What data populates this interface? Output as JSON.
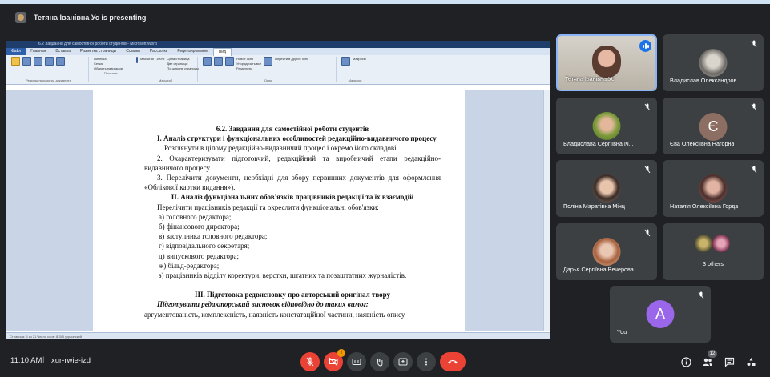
{
  "header": {
    "presenting_text": "Тетяна Іванівна Ус is presenting"
  },
  "screen": {
    "titlebar": "6.2 Завдання для самостійної роботи студентів - Microsoft Word",
    "tabs": [
      "Файл",
      "Главная",
      "Вставка",
      "Разметка страницы",
      "Ссылки",
      "Рассылки",
      "Рецензирование",
      "Вид"
    ],
    "ribbon_groups": [
      "Режимы просмотра документа",
      "Показать",
      "Масштаб",
      "Окно",
      "Макросы"
    ],
    "ribbon_items": [
      "Линейка",
      "Сетка",
      "Область навигации",
      "Масштаб",
      "100%",
      "Одна страница",
      "Две страницы",
      "По ширине страницы",
      "Новое окно",
      "Упорядочить все",
      "Разделить",
      "Перейти в другое окно",
      "Макросы"
    ],
    "status": "Страница: 5 из 21   Число слов: 8 345   украинский",
    "document": {
      "heading": "6.2. Завдання для самостійної роботи студентів",
      "section1_title": "I. Аналіз структури і функціональних особливостей редакційно-видавничого процесу",
      "items1": [
        "1. Розглянути в цілому редакційно-видавничий процес і окремо його складові.",
        "2. Охарактеризувати підготовчий, редакційний та виробничий етапи редакційно-видавничого процесу.",
        "3. Перелічити документи, необхідні для збору первинних документів для оформлення «Облікової картки видання»)."
      ],
      "section2_title": "II. Аналіз функціональних обов'язків працівників редакції та їх взаємодій",
      "section2_intro": "Перелічити працівників редакції та окреслити функціональні обов'язки:",
      "items2": [
        "а) головного редактора;",
        "б) фінансового директора;",
        "в) заступника головного редактора;",
        "г) відповідального секретаря;",
        "д) випускового редактора;",
        "ж) більд-редактора;",
        "з) працівників відділу коректури, верстки, штатних та позаштатних журналістів."
      ],
      "section3_title": "III. Підготовка редвисновку про авторський оригінал твору",
      "section3_italic": "Підготувати редакторський висновок відповідно до таких вимог:",
      "section3_text": "аргументованість, комплексність, наявність констатаційної частини, наявність опису"
    }
  },
  "participants": [
    {
      "name": "Тетяна Іванівна Ус",
      "speaking": true
    },
    {
      "name": "Владислав Олександров...",
      "muted": true
    },
    {
      "name": "Владислава Сергіївна Іч...",
      "muted": true
    },
    {
      "name": "Єва Олексіївна Нагорна",
      "muted": true,
      "initial": "Є"
    },
    {
      "name": "Поліна Маратівна Мінц",
      "muted": true
    },
    {
      "name": "Наталія Олексіївна Горда",
      "muted": true
    },
    {
      "name": "Дарья Сергіївна Вечерова",
      "muted": true
    },
    {
      "name": "3 others"
    },
    {
      "name": "You",
      "muted": true,
      "initial": "A"
    }
  ],
  "colors": {
    "accent": "#8ab4f8",
    "end_call": "#ea4335",
    "you_avatar": "#9a67ea",
    "eva_avatar": "#8d6e63"
  },
  "bottom": {
    "time": "11:10 AM",
    "separator": "|",
    "meeting_code": "xur-rwie-izd",
    "camera_badge": "!",
    "participants_count": "12"
  }
}
